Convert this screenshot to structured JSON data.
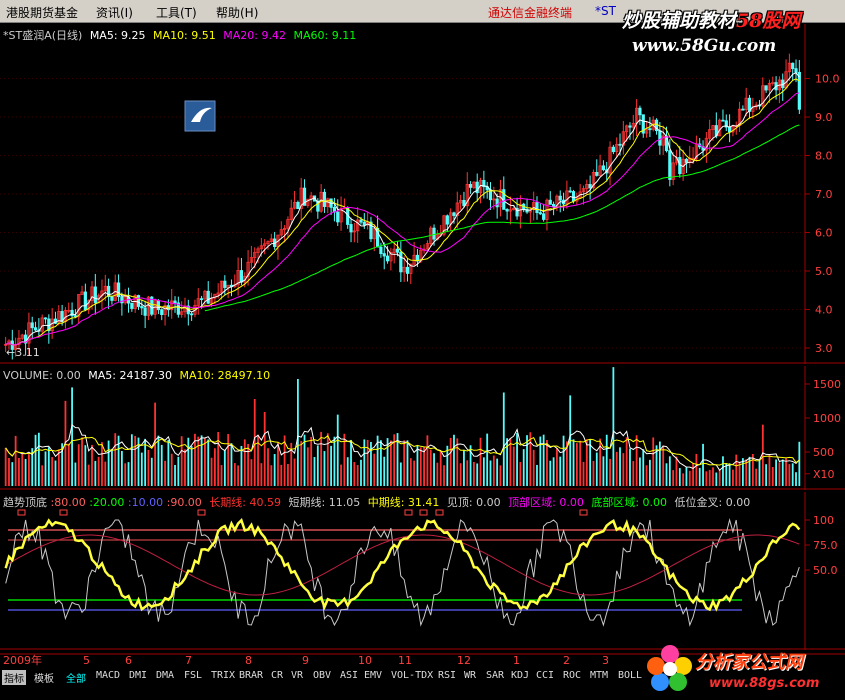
{
  "menu": {
    "items": [
      "港股期货基金",
      "资讯(I)",
      "工具(T)",
      "帮助(H)"
    ],
    "broker": "通达信金融终端",
    "code_prefix": "*ST"
  },
  "watermark_top": {
    "line1_a": "炒股辅助教材",
    "line1_b": "58股网",
    "line2": "www.58Gu.com"
  },
  "price_panel": {
    "title": "*ST盛润A(日线)",
    "ma5_label": "MA5:",
    "ma5": "9.25",
    "ma10_label": "MA10:",
    "ma10": "9.51",
    "ma20_label": "MA20:",
    "ma20": "9.42",
    "ma60_label": "MA60:",
    "ma60": "9.11",
    "low_marker": "←3.11",
    "y_ticks": [
      "10.0",
      "9.0",
      "8.0",
      "7.0",
      "6.0",
      "5.0",
      "4.0",
      "3.0"
    ]
  },
  "volume_panel": {
    "label": "VOLUME: 0.00",
    "ma5": "MA5: 24187.30",
    "ma10": "MA10: 28497.10",
    "y_ticks": [
      "1500",
      "1000",
      "500",
      "X10"
    ]
  },
  "indicator_panel": {
    "name": "趋势顶底",
    "values": [
      ":80.00",
      ":20.00",
      ":10.00",
      ":90.00"
    ],
    "long": "长期线: 40.59",
    "short": "短期线: 11.05",
    "mid": "中期线: 31.41",
    "top_see": "见顶: 0.00",
    "top_zone": "顶部区域: 0.00",
    "bottom_zone": "底部区域: 0.00",
    "low_cross": "低位金叉: 0.00",
    "y_ticks": [
      "100",
      "75.0",
      "50.0"
    ]
  },
  "date_axis": {
    "year": "2009年",
    "months": [
      "5",
      "6",
      "7",
      "8",
      "9",
      "10",
      "11",
      "12",
      "1",
      "2",
      "3"
    ]
  },
  "tabs": {
    "items": [
      "指标",
      "模板",
      "全部",
      "MACD",
      "DMI",
      "DMA",
      "FSL",
      "TRIX",
      "BRAR",
      "CR",
      "VR",
      "OBV",
      "ASI",
      "EMV",
      "VOL-TDX",
      "RSI",
      "WR",
      "SAR",
      "KDJ",
      "CCI",
      "ROC",
      "MTM",
      "BOLL"
    ]
  },
  "watermark_bottom": {
    "line1": "分析家公式网",
    "line2": "www.88gs.com"
  },
  "colors": {
    "up": "#ff3232",
    "down": "#54fcfc",
    "ma5": "#ffffff",
    "ma10": "#ffff00",
    "ma20": "#ff00ff",
    "ma60": "#00ff00"
  }
}
